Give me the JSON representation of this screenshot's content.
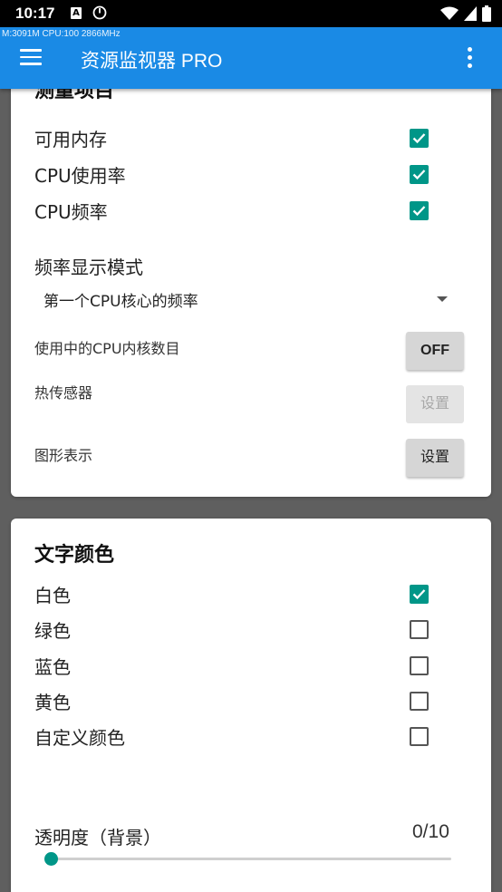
{
  "status_bar": {
    "time": "10:17",
    "notification_letter": "A"
  },
  "app_bar": {
    "monitor_text": "M:3091M CPU:100 2866MHz",
    "title": "资源监视器 PRO"
  },
  "measurement_section": {
    "heading": "测量项目",
    "items": [
      {
        "label": "可用内存",
        "checked": true
      },
      {
        "label": "CPU使用率",
        "checked": true
      },
      {
        "label": "CPU频率",
        "checked": true
      }
    ],
    "frequency_mode_label": "频率显示模式",
    "frequency_mode_value": "第一个CPU核心的频率",
    "cores_label": "使用中的CPU内核数目",
    "cores_toggle": "OFF",
    "sensor_label": "热传感器",
    "sensor_button": "设置",
    "sensor_button_enabled": false,
    "graph_label": "图形表示",
    "graph_button": "设置"
  },
  "text_color_section": {
    "heading": "文字颜色",
    "options": [
      {
        "label": "白色",
        "checked": true
      },
      {
        "label": "绿色",
        "checked": false
      },
      {
        "label": "蓝色",
        "checked": false
      },
      {
        "label": "黄色",
        "checked": false
      },
      {
        "label": "自定义颜色",
        "checked": false
      }
    ],
    "transparency_label": "透明度（背景）",
    "transparency_value": "0/10",
    "transparency_level": 0,
    "transparency_max": 10
  },
  "colors": {
    "app_bar": "#1a8ae5",
    "accent": "#009688",
    "background": "#5f5f5f",
    "status_bar": "#000000"
  }
}
